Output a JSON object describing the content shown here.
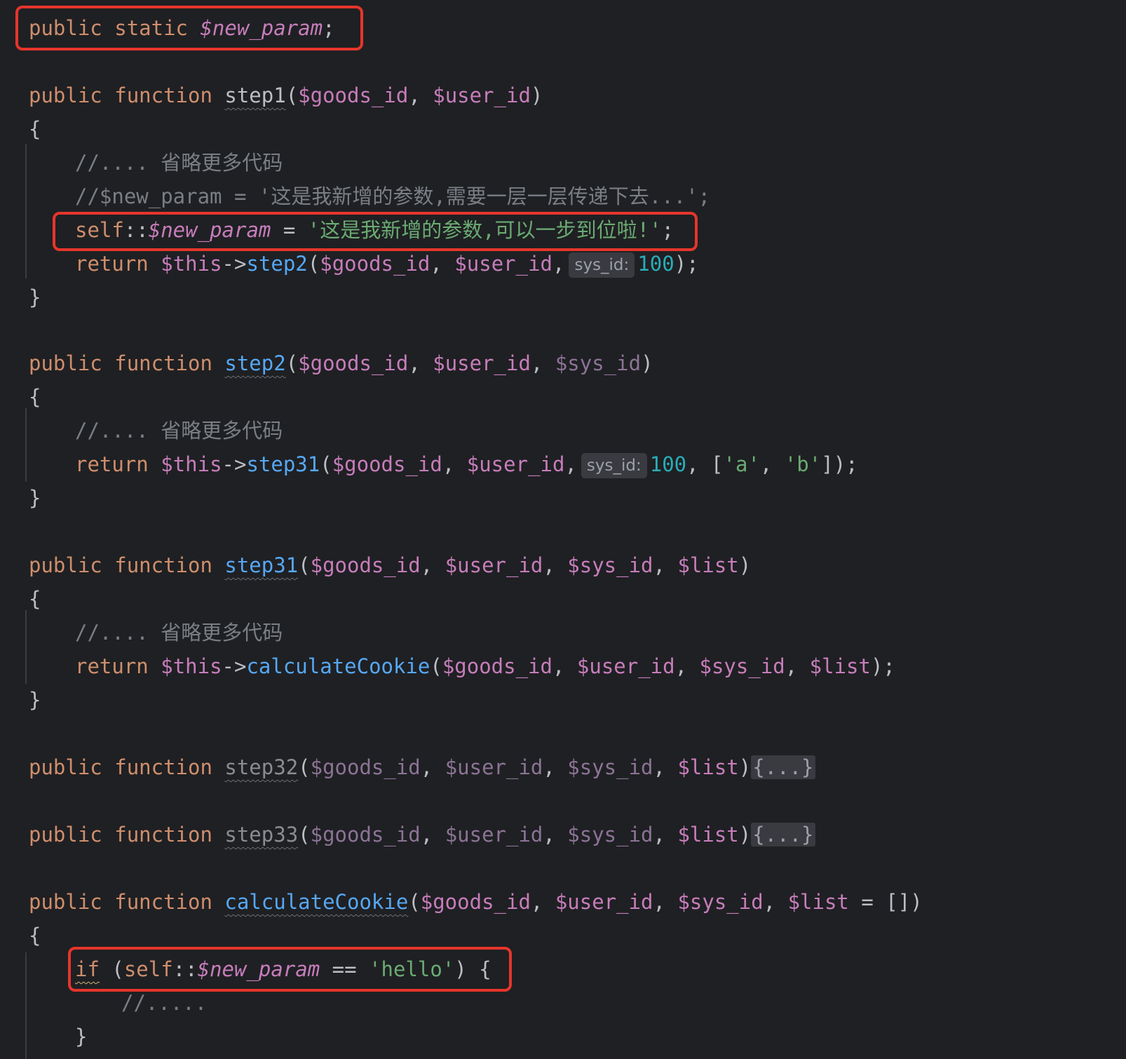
{
  "code": {
    "kw_public": "public",
    "kw_static": "static",
    "kw_function": "function",
    "kw_return": "return",
    "kw_self": "self",
    "kw_if": "if",
    "var_new_param": "$new_param",
    "var_this": "$this",
    "var_goods_id": "$goods_id",
    "var_user_id": "$user_id",
    "var_sys_id": "$sys_id",
    "var_list": "$list",
    "fn_step1": "step1",
    "fn_step2": "step2",
    "fn_step31": "step31",
    "fn_step32": "step32",
    "fn_step33": "step33",
    "fn_calculate": "calculateCookie",
    "comment_omit": "//.... 省略更多代码",
    "comment_passdown": "//$new_param = '这是我新增的参数,需要一层一层传递下去...';",
    "str_new_param": "'这是我新增的参数,可以一步到位啦!'",
    "str_a": "'a'",
    "str_b": "'b'",
    "str_hello": "'hello'",
    "num_100": "100",
    "hint_sys_id": "sys_id:",
    "fold_body": "{...}",
    "comment_inner": "//.....",
    "open_brace": "{",
    "close_brace": "}"
  }
}
